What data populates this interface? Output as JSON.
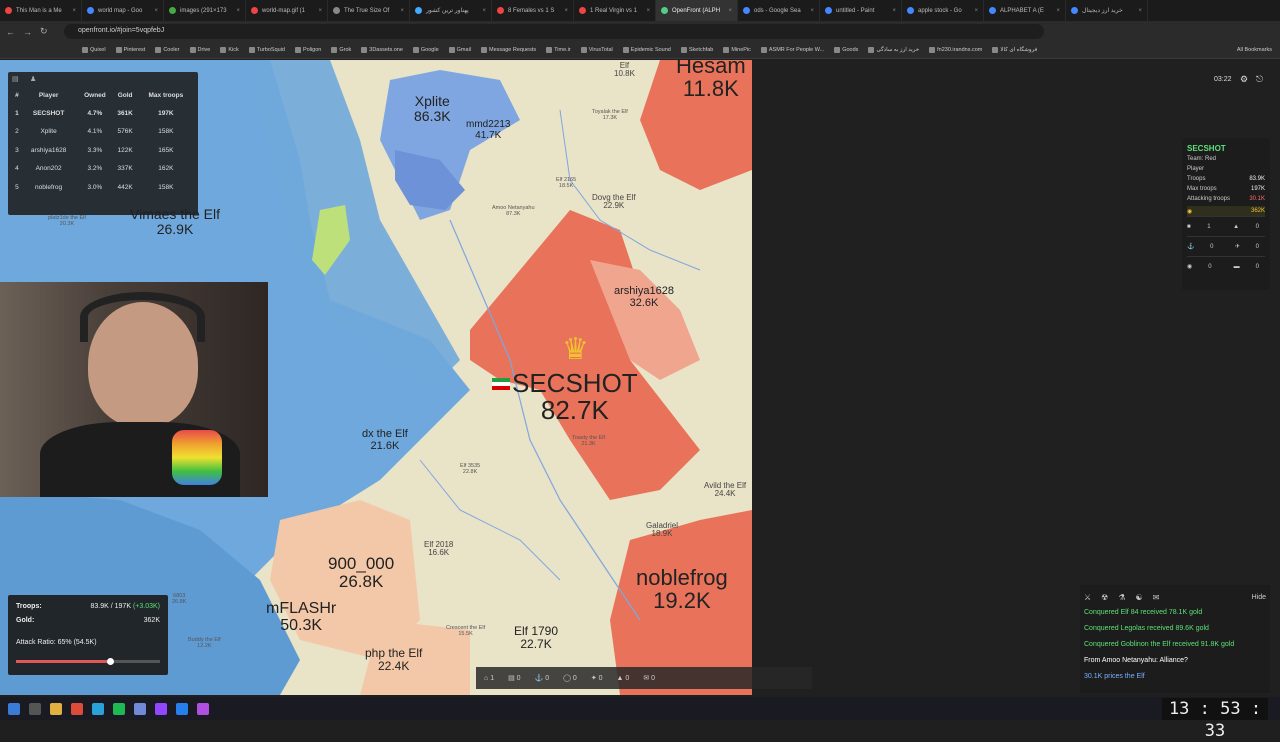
{
  "browser": {
    "tabs": [
      "This Man is a Me",
      "world map - Goo",
      "images (291×173",
      "world-map.gif (1",
      "The True Size Of",
      "پهناور ترین کشور",
      "8 Females vs 1 S",
      "1 Real Virgin vs 1",
      "OpenFront (ALPH",
      "ods - Google Sea",
      "untitled - Paint",
      "apple stock - Go",
      "ALPHABET A (E",
      "خرید ارز دیجیتال"
    ],
    "active_tab_index": 8,
    "url": "openfront.io/#join=5vqpfebJ",
    "bookmarks": [
      "Quixel",
      "Pinterest",
      "Cooler",
      "Drive",
      "Kick",
      "TurboSquid",
      "Poligon",
      "Grok",
      "3Dassets.one",
      "Google",
      "Gmail",
      "Message Requests",
      "Time.ir",
      "VirusTotal",
      "Epidemic Sound",
      "Sketchfab",
      "MinePic",
      "ASMR For People W...",
      "Goods",
      "خرید ارز به سادگی",
      "fn230.irandns.com",
      "فروشگاه ای کالا"
    ],
    "all_bookmarks": "All Bookmarks"
  },
  "game_timer": "03:22",
  "leaderboard": {
    "headers": [
      "#",
      "Player",
      "Owned",
      "Gold",
      "Max troops"
    ],
    "rows": [
      [
        "1",
        "SECSHOT",
        "4.7%",
        "361K",
        "197K"
      ],
      [
        "2",
        "Xplite",
        "4.1%",
        "576K",
        "158K"
      ],
      [
        "3",
        "arshiya1628",
        "3.3%",
        "122K",
        "165K"
      ],
      [
        "4",
        "Anon202",
        "3.2%",
        "337K",
        "162K"
      ],
      [
        "5",
        "noblefrog",
        "3.0%",
        "442K",
        "158K"
      ]
    ]
  },
  "map_labels": [
    {
      "name": "Xplite",
      "value": "86.3K"
    },
    {
      "name": "mmd2213",
      "value": "41.7K"
    },
    {
      "name": "Hesam",
      "value": "11.8K"
    },
    {
      "name": "SECSHOT",
      "value": "82.7K"
    },
    {
      "name": "arshiya1628",
      "value": "32.6K"
    },
    {
      "name": "Vimaes the Elf",
      "value": "26.9K"
    },
    {
      "name": "Dovg the Elf",
      "value": "22.9K"
    },
    {
      "name": "dx the Elf",
      "value": "21.6K"
    },
    {
      "name": "900_000",
      "value": "26.8K"
    },
    {
      "name": "mFLASHr",
      "value": "50.3K"
    },
    {
      "name": "noblefrog",
      "value": "19.2K"
    },
    {
      "name": "Elf 1790",
      "value": "22.7K"
    },
    {
      "name": "php the Elf",
      "value": "22.4K"
    },
    {
      "name": "Avild the Elf",
      "value": "24.4K"
    },
    {
      "name": "Galadriel",
      "value": "18.9K"
    },
    {
      "name": "Elf 2018",
      "value": "16.6K"
    },
    {
      "name": "Toyalak the Elf",
      "value": "17.3K"
    },
    {
      "name": "platz1de the Elf",
      "value": "20.3K"
    },
    {
      "name": "Buddy the Elf",
      "value": "12.2K"
    },
    {
      "name": "6803",
      "value": "26.8K"
    },
    {
      "name": "Amoo Netanyahu",
      "value": "87.3K"
    },
    {
      "name": "Elf 2165",
      "value": "18.5K"
    },
    {
      "name": "Elf 3535",
      "value": "22.8K"
    },
    {
      "name": "Crescent the Elf",
      "value": "15.5K"
    },
    {
      "name": "Toasty the Elf",
      "value": "21.3K"
    },
    {
      "name": "Elf",
      "value": "10.8K"
    }
  ],
  "player_panel": {
    "name": "SECSHOT",
    "team_label": "Team: Red",
    "type": "Player",
    "rows": [
      {
        "label": "Troops",
        "value": "83.9K"
      },
      {
        "label": "Max troops",
        "value": "197K"
      },
      {
        "label": "Attacking troops",
        "value": "30.1K"
      }
    ],
    "gold": "362K",
    "counts": [
      "1",
      "0",
      "0",
      "0",
      "0",
      "0"
    ]
  },
  "resources": {
    "troops_label": "Troops:",
    "troops_value": "83.9K / 197K",
    "troops_delta": "(+3.03K)",
    "gold_label": "Gold:",
    "gold_value": "362K",
    "attack_ratio_label": "Attack Ratio: 65% (54.5K)",
    "attack_ratio": 0.65
  },
  "unit_bar": [
    "1",
    "0",
    "0",
    "0",
    "0",
    "0",
    "0"
  ],
  "events": {
    "hide_label": "Hide",
    "items": [
      {
        "text": "Conquered Elf 84 received 78.1K gold",
        "color": "#5ee07a"
      },
      {
        "text": "Conquered Legolas received 89.6K gold",
        "color": "#5ee07a"
      },
      {
        "text": "Conquered Goblinon the Elf received 91.8K gold",
        "color": "#5ee07a"
      },
      {
        "text": "From Amoo Netanyahu: Alliance?",
        "color": "#ffffff"
      },
      {
        "text": "30.1K prices the Elf",
        "color": "#7ab0ff"
      }
    ]
  },
  "clock": "13 : 53 : 33",
  "colors": {
    "own": "#e8735a",
    "own_light": "#f0a58f",
    "ally_blue": "#7fa6e0",
    "land": "#e9e3c8",
    "water": "#6fa8dc",
    "green": "#bde07a"
  }
}
